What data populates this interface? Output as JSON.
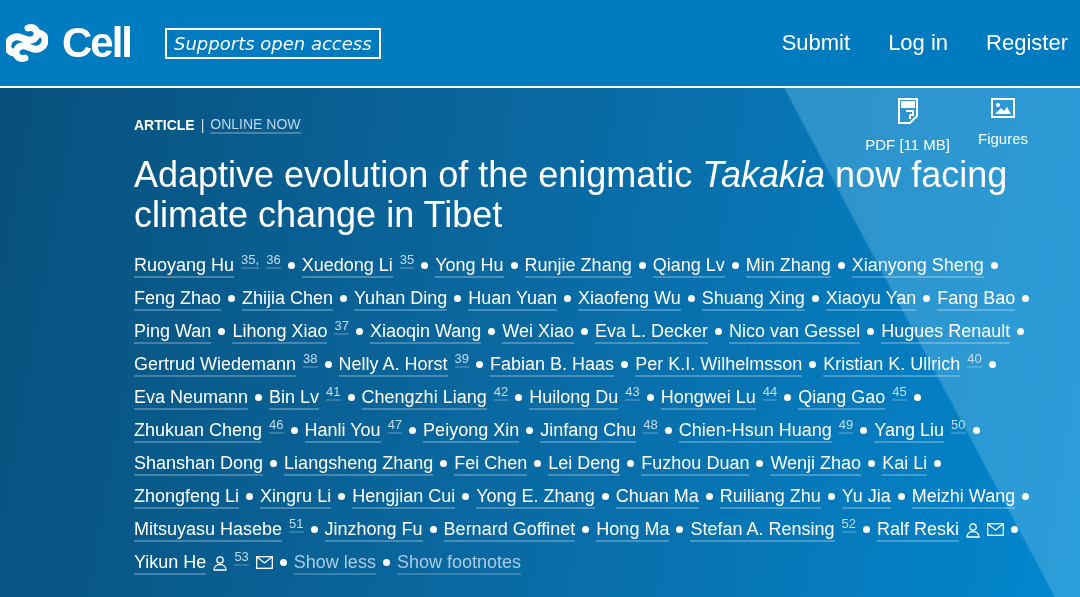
{
  "header": {
    "logo": "Cell",
    "badge": "Supports open access",
    "nav": [
      "Submit",
      "Log in",
      "Register"
    ]
  },
  "article": {
    "type": "ARTICLE",
    "divider": "|",
    "status": "ONLINE NOW",
    "title": "Adaptive evolution of the enigmatic *Takakia* now facing climate change in Tibet",
    "tools": [
      {
        "kind": "pdf",
        "label": "PDF [11 MB]"
      },
      {
        "kind": "figures",
        "label": "Figures"
      }
    ],
    "authors": [
      {
        "name": "Ruoyang Hu",
        "sups": [
          "35,",
          "36"
        ]
      },
      {
        "name": "Xuedong Li",
        "sups": [
          "35"
        ]
      },
      {
        "name": "Yong Hu"
      },
      {
        "name": "Runjie Zhang"
      },
      {
        "name": "Qiang Lv"
      },
      {
        "name": "Min Zhang"
      },
      {
        "name": "Xianyong Sheng"
      },
      {
        "name": "Feng Zhao"
      },
      {
        "name": "Zhijia Chen"
      },
      {
        "name": "Yuhan Ding"
      },
      {
        "name": "Huan Yuan"
      },
      {
        "name": "Xiaofeng Wu"
      },
      {
        "name": "Shuang Xing"
      },
      {
        "name": "Xiaoyu Yan"
      },
      {
        "name": "Fang Bao"
      },
      {
        "name": "Ping Wan"
      },
      {
        "name": "Lihong Xiao",
        "sups": [
          "37"
        ]
      },
      {
        "name": "Xiaoqin Wang"
      },
      {
        "name": "Wei Xiao"
      },
      {
        "name": "Eva L. Decker"
      },
      {
        "name": "Nico van Gessel"
      },
      {
        "name": "Hugues Renault"
      },
      {
        "name": "Gertrud Wiedemann",
        "sups": [
          "38"
        ]
      },
      {
        "name": "Nelly A. Horst",
        "sups": [
          "39"
        ]
      },
      {
        "name": "Fabian B. Haas"
      },
      {
        "name": "Per K.I. Wilhelmsson"
      },
      {
        "name": "Kristian K. Ullrich",
        "sups": [
          "40"
        ]
      },
      {
        "name": "Eva Neumann"
      },
      {
        "name": "Bin Lv",
        "sups": [
          "41"
        ]
      },
      {
        "name": "Chengzhi Liang",
        "sups": [
          "42"
        ]
      },
      {
        "name": "Huilong Du",
        "sups": [
          "43"
        ]
      },
      {
        "name": "Hongwei Lu",
        "sups": [
          "44"
        ]
      },
      {
        "name": "Qiang Gao",
        "sups": [
          "45"
        ]
      },
      {
        "name": "Zhukuan Cheng",
        "sups": [
          "46"
        ]
      },
      {
        "name": "Hanli You",
        "sups": [
          "47"
        ]
      },
      {
        "name": "Peiyong Xin"
      },
      {
        "name": "Jinfang Chu",
        "sups": [
          "48"
        ]
      },
      {
        "name": "Chien-Hsun Huang",
        "sups": [
          "49"
        ]
      },
      {
        "name": "Yang Liu",
        "sups": [
          "50"
        ]
      },
      {
        "name": "Shanshan Dong"
      },
      {
        "name": "Liangsheng Zhang"
      },
      {
        "name": "Fei Chen"
      },
      {
        "name": "Lei Deng"
      },
      {
        "name": "Fuzhou Duan"
      },
      {
        "name": "Wenji Zhao"
      },
      {
        "name": "Kai Li"
      },
      {
        "name": "Zhongfeng Li"
      },
      {
        "name": "Xingru Li"
      },
      {
        "name": "Hengjian Cui"
      },
      {
        "name": "Yong E. Zhang"
      },
      {
        "name": "Chuan Ma"
      },
      {
        "name": "Ruiliang Zhu"
      },
      {
        "name": "Yu Jia"
      },
      {
        "name": "Meizhi Wang"
      },
      {
        "name": "Mitsuyasu Hasebe",
        "sups": [
          "51"
        ]
      },
      {
        "name": "Jinzhong Fu"
      },
      {
        "name": "Bernard Goffinet"
      },
      {
        "name": "Hong Ma"
      },
      {
        "name": "Stefan A. Rensing",
        "sups": [
          "52"
        ]
      },
      {
        "name": "Ralf Reski",
        "corresponding": true,
        "email": true
      },
      {
        "name": "Yikun He",
        "corresponding": true,
        "sups": [
          "53"
        ],
        "email": true
      }
    ],
    "show_less": "Show less",
    "show_footnotes": "Show footnotes"
  }
}
